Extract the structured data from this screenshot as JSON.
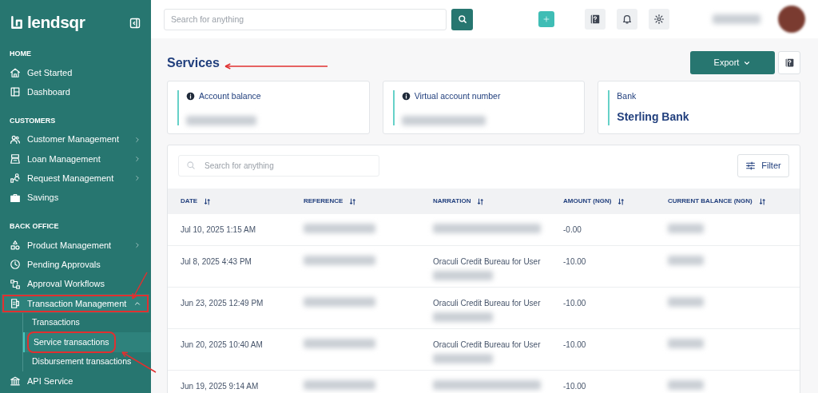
{
  "sidebar": {
    "logo": "lendsqr",
    "sections": [
      {
        "title": "HOME",
        "items": [
          {
            "label": "Get Started",
            "expandable": false,
            "expanded": false,
            "highlighted": false
          },
          {
            "label": "Dashboard",
            "expandable": false,
            "expanded": false,
            "highlighted": false
          }
        ]
      },
      {
        "title": "CUSTOMERS",
        "items": [
          {
            "label": "Customer Management",
            "expandable": true,
            "expanded": false,
            "highlighted": false
          },
          {
            "label": "Loan Management",
            "expandable": true,
            "expanded": false,
            "highlighted": false
          },
          {
            "label": "Request Management",
            "expandable": true,
            "expanded": false,
            "highlighted": false
          },
          {
            "label": "Savings",
            "expandable": false,
            "expanded": false,
            "highlighted": false
          }
        ]
      },
      {
        "title": "BACK OFFICE",
        "items": [
          {
            "label": "Product Management",
            "expandable": true,
            "expanded": false,
            "highlighted": false
          },
          {
            "label": "Pending Approvals",
            "expandable": false,
            "expanded": false,
            "highlighted": false
          },
          {
            "label": "Approval Workflows",
            "expandable": false,
            "expanded": false,
            "highlighted": false
          },
          {
            "label": "Transaction Management",
            "expandable": true,
            "expanded": true,
            "highlighted": true,
            "children": [
              {
                "label": "Transactions",
                "selected": false,
                "highlighted": false
              },
              {
                "label": "Service transactions",
                "selected": true,
                "highlighted": true
              },
              {
                "label": "Disbursement transactions",
                "selected": false,
                "highlighted": false
              }
            ]
          },
          {
            "label": "API Service",
            "expandable": false,
            "expanded": false,
            "highlighted": false
          }
        ]
      }
    ]
  },
  "topbar": {
    "search": {
      "placeholder": "Search for anything"
    }
  },
  "page": {
    "title": "Services",
    "title_annotated": true,
    "export_button": "Export"
  },
  "stats": [
    {
      "label": "Account balance",
      "info_icon": true
    },
    {
      "label": "Virtual account number",
      "info_icon": true
    },
    {
      "label": "Bank",
      "info_icon": false,
      "value": "Sterling Bank"
    }
  ],
  "table": {
    "search": {
      "placeholder": "Search for anything"
    },
    "filter_button": "Filter",
    "columns": [
      "DATE",
      "REFERENCE",
      "NARRATION",
      "AMOUNT (NGN)",
      "CURRENT BALANCE (NGN)"
    ],
    "rows": [
      {
        "date": "Jul 10, 2025 1:15 AM",
        "narration": "",
        "amount": "-0.00"
      },
      {
        "date": "Jul 8, 2025 4:43 PM",
        "narration": "Oraculi Credit Bureau for User",
        "amount": "-10.00"
      },
      {
        "date": "Jun 23, 2025 12:49 PM",
        "narration": "Oraculi Credit Bureau for User",
        "amount": "-10.00"
      },
      {
        "date": "Jun 20, 2025 10:40 AM",
        "narration": "Oraculi Credit Bureau for User",
        "amount": "-10.00"
      },
      {
        "date": "Jun 19, 2025 9:14 AM",
        "narration": "",
        "amount": "-10.00"
      }
    ]
  }
}
